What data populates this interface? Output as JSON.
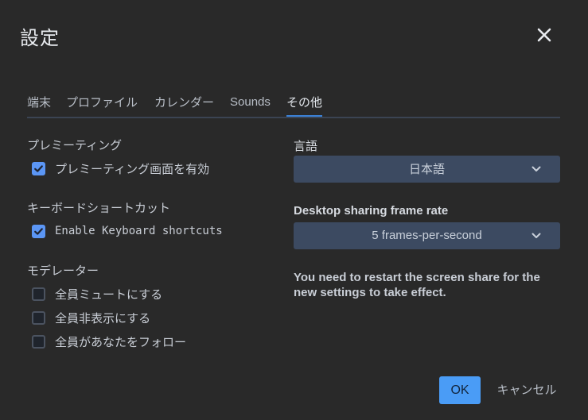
{
  "dialog": {
    "title": "設定",
    "close_icon": "close-icon"
  },
  "tabs": [
    {
      "label": "端末",
      "active": false
    },
    {
      "label": "プロファイル",
      "active": false
    },
    {
      "label": "カレンダー",
      "active": false
    },
    {
      "label": "Sounds",
      "active": false
    },
    {
      "label": "その他",
      "active": true
    }
  ],
  "left": {
    "premeeting": {
      "title": "プレミーティング",
      "enable": {
        "label": "プレミーティング画面を有効",
        "checked": true
      }
    },
    "shortcuts": {
      "title": "キーボードショートカット",
      "enable": {
        "label": "Enable Keyboard shortcuts",
        "checked": true
      }
    },
    "moderator": {
      "title": "モデレーター",
      "options": [
        {
          "label": "全員ミュートにする",
          "checked": false
        },
        {
          "label": "全員非表示にする",
          "checked": false
        },
        {
          "label": "全員があなたをフォロー",
          "checked": false
        }
      ]
    }
  },
  "right": {
    "language": {
      "label": "言語",
      "value": "日本語"
    },
    "framerate": {
      "label": "Desktop sharing frame rate",
      "value": "5 frames-per-second"
    },
    "notice": "You need to restart the screen share for the new settings to take effect."
  },
  "footer": {
    "ok_label": "OK",
    "cancel_label": "キャンセル"
  },
  "colors": {
    "background": "#292929",
    "accent": "#4a9cf6",
    "checkbox_checked": "#5b96f5",
    "select_bg": "#3c4a61",
    "tab_underline": "#3b81d6"
  }
}
